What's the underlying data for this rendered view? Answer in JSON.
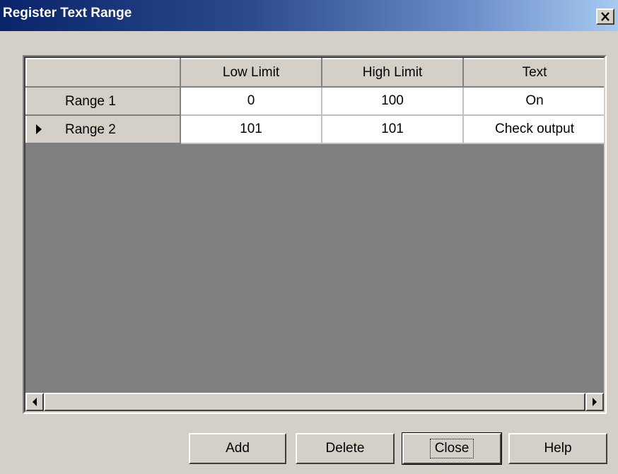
{
  "window": {
    "title": "Register Text Range",
    "close_glyph": "×"
  },
  "grid": {
    "columns": [
      "Low Limit",
      "High Limit",
      "Text"
    ],
    "rows": [
      {
        "label": "Range 1",
        "low": "0",
        "high": "100",
        "text": "On",
        "current": false
      },
      {
        "label": "Range 2",
        "low": "101",
        "high": "101",
        "text": "Check output",
        "current": true
      }
    ],
    "row_pointer_icon": "triangle-right-icon",
    "empty_area_color": "#808080"
  },
  "scrollbar": {
    "left_icon": "arrow-left-icon",
    "right_icon": "arrow-right-icon"
  },
  "buttons": {
    "add": "Add",
    "delete": "Delete",
    "close": "Close",
    "help": "Help"
  },
  "colors": {
    "title_bar_start": "#0a246a",
    "title_bar_end": "#a6caf0",
    "face": "#d4d0c8"
  }
}
